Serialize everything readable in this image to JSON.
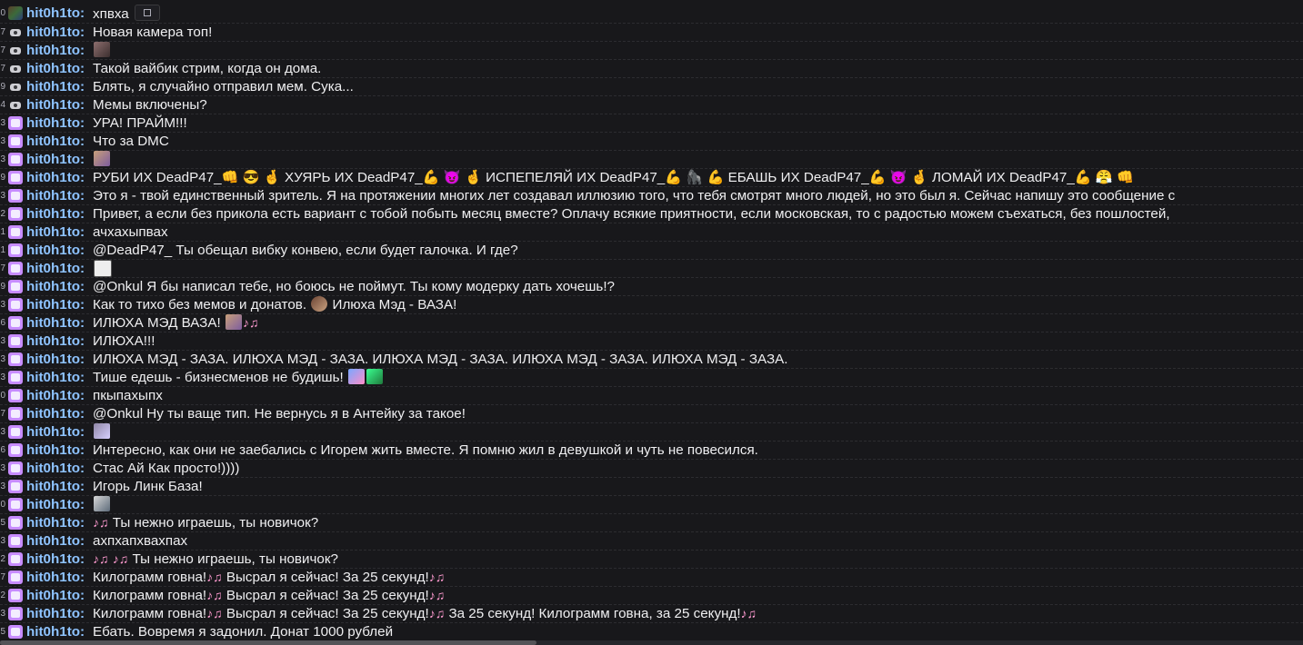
{
  "username": "hit0h1to:",
  "messages": [
    {
      "n": "0",
      "badge": "pic",
      "text": "хпвха",
      "ext": true
    },
    {
      "n": "7",
      "badge": "cam",
      "text": "Новая камера топ!"
    },
    {
      "n": "7",
      "badge": "cam",
      "text": "",
      "emotes": [
        "e8"
      ]
    },
    {
      "n": "7",
      "badge": "cam",
      "text": "Такой вайбик стрим, когда он дома."
    },
    {
      "n": "9",
      "badge": "cam",
      "text": "Блять, я случайно отправил мем. Сука..."
    },
    {
      "n": "4",
      "badge": "cam",
      "text": "Мемы включены?"
    },
    {
      "n": "3",
      "badge": "sub",
      "text": "УРА! ПРАЙМ!!!"
    },
    {
      "n": "3",
      "badge": "sub",
      "text": "Что за DMC"
    },
    {
      "n": "3",
      "badge": "sub",
      "text": "",
      "emotes": [
        "e1"
      ]
    },
    {
      "n": "9",
      "badge": "sub",
      "text": "РУБИ ИХ DeadP47_👊 😎 🤞 ХУЯРЬ ИХ DeadP47_💪 😈 🤞 ИСПЕПЕЛЯЙ ИХ DeadP47_💪 🦍 💪 ЕБАШЬ ИХ DeadP47_💪 😈 🤞 ЛОМАЙ ИХ DeadP47_💪 😤 👊"
    },
    {
      "n": "3",
      "badge": "sub",
      "text": "Это я - твой единственный зритель. Я на протяжении многих лет создавал иллюзию того, что тебя смотрят много людей, но это был я. Сейчас напишу это сообщение с"
    },
    {
      "n": "2",
      "badge": "sub",
      "text": "Привет, а если без прикола есть вариант с тобой побыть месяц вместе? Оплачу всякие приятности, если московская, то с радостью можем съехаться, без пошлостей,"
    },
    {
      "n": "1",
      "badge": "sub",
      "text": "ачхахыпвах"
    },
    {
      "n": "1",
      "badge": "sub",
      "text": "@DeadP47_ Ты обещал вибку конвею, если будет галочка. И где?"
    },
    {
      "n": "7",
      "badge": "sub",
      "text": "",
      "emotes": [
        "e2"
      ]
    },
    {
      "n": "9",
      "badge": "sub",
      "text": "@Onkul Я бы написал тебе, но боюсь не поймут. Ты кому модерку дать хочешь!?"
    },
    {
      "n": "3",
      "badge": "sub",
      "text": "Как то тихо без мемов и донатов.",
      "emotes_after": [
        "e6"
      ],
      "text2": "Илюха Мэд - ВАЗА!"
    },
    {
      "n": "6",
      "badge": "sub",
      "text": "ИЛЮХА МЭД ВАЗА!",
      "emotes_after": [
        "e1"
      ],
      "note": "♪♫"
    },
    {
      "n": "3",
      "badge": "sub",
      "text": "ИЛЮХА!!!"
    },
    {
      "n": "3",
      "badge": "sub",
      "text": "ИЛЮХА МЭД - ЗАЗА. ИЛЮХА МЭД - ЗАЗА. ИЛЮХА МЭД - ЗАЗА. ИЛЮХА МЭД - ЗАЗА. ИЛЮХА МЭД - ЗАЗА."
    },
    {
      "n": "3",
      "badge": "sub",
      "text": "Тише едешь - бизнесменов не будишь!",
      "emotes_after": [
        "e7",
        "e3"
      ]
    },
    {
      "n": "0",
      "badge": "sub",
      "text": "пкыпахыпх"
    },
    {
      "n": "7",
      "badge": "sub",
      "text": "@Onkul Ну ты ваще тип. Не вернусь я в Антейку за такое!"
    },
    {
      "n": "3",
      "badge": "sub",
      "text": "",
      "emotes": [
        "e4"
      ]
    },
    {
      "n": "6",
      "badge": "sub",
      "text": "Интересно, как они не заебались с Игорем жить вместе. Я помню жил в девушкой и чуть не повесился."
    },
    {
      "n": "3",
      "badge": "sub",
      "text": "Стас Ай Как просто!))))"
    },
    {
      "n": "3",
      "badge": "sub",
      "text": "Игорь Линк База!"
    },
    {
      "n": "0",
      "badge": "sub",
      "text": "",
      "emotes": [
        "e5"
      ]
    },
    {
      "n": "5",
      "badge": "sub",
      "text": "",
      "note_before": "♪♫",
      "text2": "Ты нежно играешь, ты новичок?"
    },
    {
      "n": "3",
      "badge": "sub",
      "text": "ахпхапхвахпах"
    },
    {
      "n": "2",
      "badge": "sub",
      "text": "",
      "note_before": "♪♫",
      "text2": "Ты нежно играешь, ты новичок?",
      "note": "♪♫"
    },
    {
      "n": "7",
      "badge": "sub",
      "text": "Килограмм говна!",
      "note": "♪♫",
      "text2": "Высрал я сейчас! За 25 секунд!",
      "note2": "♪♫"
    },
    {
      "n": "2",
      "badge": "sub",
      "text": "Килограмм говна!",
      "note": "♪♫",
      "text2": "Высрал я сейчас! За 25 секунд!",
      "note2": "♪♫"
    },
    {
      "n": "3",
      "badge": "sub",
      "text": "Килограмм говна!",
      "note": "♪♫",
      "text2": "Высрал я сейчас! За 25 секунд!",
      "note2": "♪♫",
      "text3": "За 25 секунд! Килограмм говна, за 25 секунд!",
      "note3": "♪♫"
    },
    {
      "n": "5",
      "badge": "sub",
      "text": "Ебать. Вовремя я задонил. Донат 1000 рублей"
    }
  ]
}
